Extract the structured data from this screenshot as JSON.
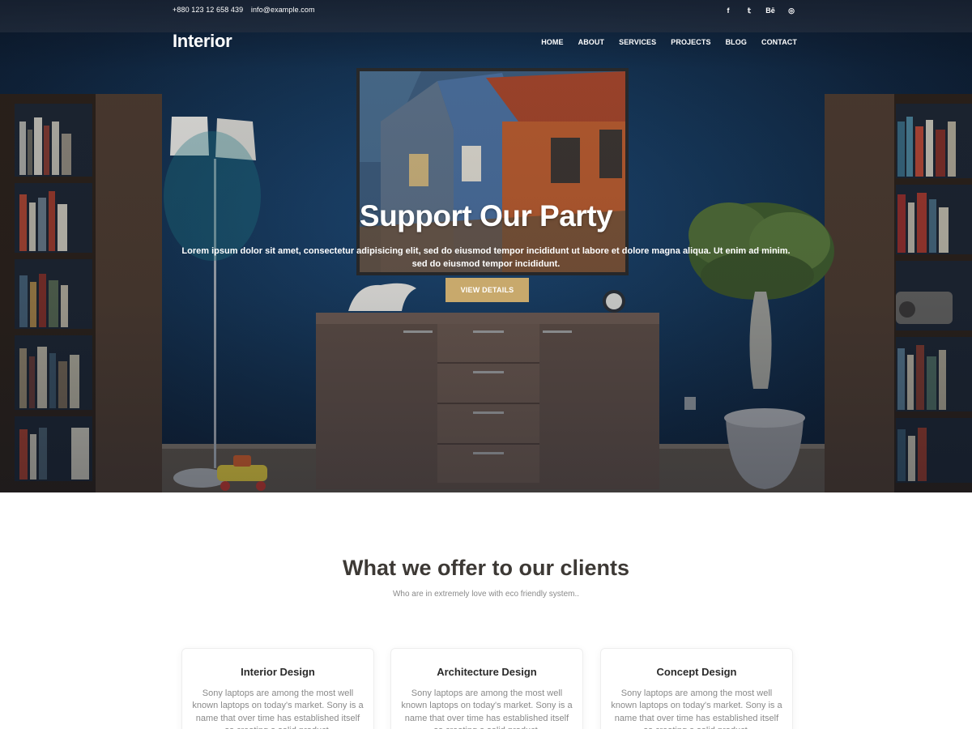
{
  "topbar": {
    "phone": "+880 123 12 658 439",
    "email": "info@example.com",
    "social": [
      {
        "icon": "facebook-icon",
        "glyph": "f"
      },
      {
        "icon": "twitter-icon",
        "glyph": "𝕥"
      },
      {
        "icon": "behance-icon",
        "glyph": "Bē"
      },
      {
        "icon": "dribbble-icon",
        "glyph": "◎"
      }
    ]
  },
  "header": {
    "logo": "Interior",
    "nav": [
      "HOME",
      "ABOUT",
      "SERVICES",
      "PROJECTS",
      "BLOG",
      "CONTACT"
    ]
  },
  "hero": {
    "title": "Support Our Party",
    "text": "Lorem ipsum dolor sit amet, consectetur adipisicing elit, sed do eiusmod tempor incididunt ut labore et dolore magna aliqua. Ut enim ad minim. sed do eiusmod tempor incididunt.",
    "button": "VIEW DETAILS"
  },
  "offer": {
    "title": "What we offer to our clients",
    "subtitle": "Who are in extremely love with eco friendly system..",
    "cards": [
      {
        "title": "Interior Design",
        "text": "Sony laptops are among the most well known laptops on today's market. Sony is a name that over time has established itself as creating a solid product."
      },
      {
        "title": "Architecture Design",
        "text": "Sony laptops are among the most well known laptops on today's market. Sony is a name that over time has established itself as creating a solid product."
      },
      {
        "title": "Concept Design",
        "text": "Sony laptops are among the most well known laptops on today's market. Sony is a name that over time has established itself as creating a solid product."
      }
    ]
  },
  "colors": {
    "accent": "#c8a96c",
    "wall": "#153556",
    "heading": "#3d3935",
    "muted": "#8a8a8a"
  }
}
